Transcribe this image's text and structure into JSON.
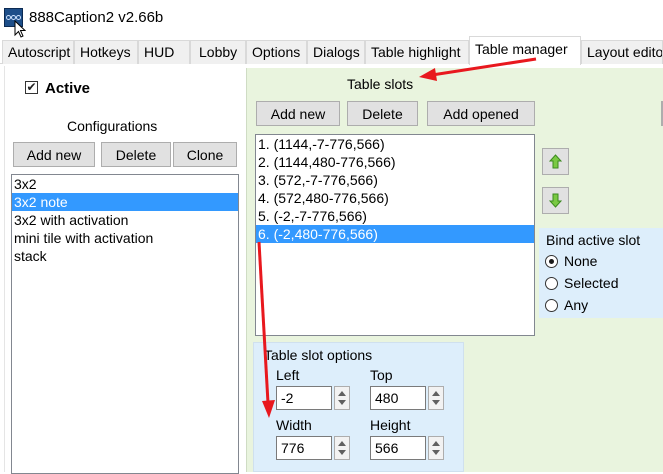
{
  "window": {
    "title": "888Caption2 v2.66b",
    "app_icon": "888-logo-icon"
  },
  "tabs": [
    "Autoscript",
    "Hotkeys",
    "HUD",
    "Lobby",
    "Options",
    "Dialogs",
    "Table highlight",
    "Table manager",
    "Layout editor"
  ],
  "active_tab": "Table manager",
  "left": {
    "active_label": "Active",
    "active_checked": true,
    "configurations_label": "Configurations",
    "buttons": {
      "add_new": "Add new",
      "delete": "Delete",
      "clone": "Clone"
    },
    "configurations": [
      "3x2",
      "3x2 note",
      "3x2 with activation",
      "mini tile with activation",
      "stack"
    ],
    "selected_configuration": "3x2 note"
  },
  "right": {
    "table_slots_label": "Table slots",
    "buttons": {
      "add_new": "Add new",
      "delete": "Delete",
      "add_opened": "Add opened"
    },
    "slots": [
      "1. (1144,-7-776,566)",
      "2. (1144,480-776,566)",
      "3. (572,-7-776,566)",
      "4. (572,480-776,566)",
      "5. (-2,-7-776,566)",
      "6. (-2,480-776,566)"
    ],
    "selected_slot": "6. (-2,480-776,566)",
    "move_up_icon": "arrow-up-icon",
    "move_down_icon": "arrow-down-icon",
    "bind_active_slot": {
      "label": "Bind active slot",
      "options": [
        "None",
        "Selected",
        "Any"
      ],
      "selected": "None"
    },
    "table_slot_options": {
      "label": "Table slot options",
      "left_label": "Left",
      "left_value": "-2",
      "top_label": "Top",
      "top_value": "480",
      "width_label": "Width",
      "width_value": "776",
      "height_label": "Height",
      "height_value": "566"
    }
  },
  "colors": {
    "accent_selection": "#3399ff",
    "annotation_arrow": "#e8181e",
    "right_panel_bg": "#e9f4de",
    "group_bg": "#ddeefb"
  }
}
